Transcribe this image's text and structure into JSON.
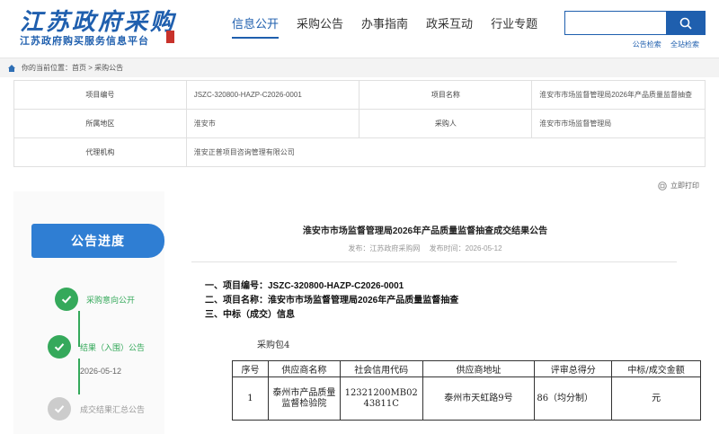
{
  "header": {
    "logo_cn": "江苏政府采购",
    "logo_sub": "江苏政府购买服务信息平台",
    "nav": [
      "信息公开",
      "采购公告",
      "办事指南",
      "政采互动",
      "行业专题"
    ],
    "active_nav": 0,
    "search_links": [
      "公告检索",
      "全站检索"
    ]
  },
  "breadcrumb": {
    "text": "你的当前位置：首页 > 采购公告"
  },
  "info": {
    "project_no_label": "项目编号",
    "project_no": "JSZC-320800-HAZP-C2026-0001",
    "project_name_label": "项目名称",
    "project_name": "淮安市市场监督管理局2026年产品质量监督抽查",
    "region_label": "所属地区",
    "region": "淮安市",
    "purchaser_label": "采购人",
    "purchaser": "淮安市市场监督管理局",
    "agency_label": "代理机构",
    "agency": "淮安正普项目咨询管理有限公司"
  },
  "print_label": "立即打印",
  "progress": {
    "title": "公告进度",
    "steps": [
      {
        "label": "采购意向公开",
        "date": "",
        "state": "done"
      },
      {
        "label": "结果（入围）公告",
        "date": "2026-05-12",
        "state": "current"
      },
      {
        "label": "成交结果汇总公告",
        "date": "",
        "state": "pending"
      }
    ]
  },
  "announcement": {
    "title": "淮安市市场监督管理局2026年产品质量监督抽查成交结果公告",
    "publisher": "发布：江苏政府采购网",
    "publish_time": "发布时间：2026-05-12",
    "line1": "一、项目编号：JSZC-320800-HAZP-C2026-0001",
    "line2": "二、项目名称：淮安市市场监督管理局2026年产品质量监督抽查",
    "line3": "三、中标（成交）信息"
  },
  "result": {
    "package": "采购包4",
    "headers": [
      "序号",
      "供应商名称",
      "社会信用代码",
      "供应商地址",
      "评审总得分",
      "中标/成交金额"
    ],
    "rows": [
      [
        "1",
        "泰州市产品质量监督检验院",
        "12321200MB0243811C",
        "泰州市天虹路9号",
        "86（均分制）",
        "元"
      ]
    ]
  },
  "colors": {
    "brand": "#1f5fae",
    "progress_green": "#35a95b",
    "side_title": "#2f7ed3"
  }
}
